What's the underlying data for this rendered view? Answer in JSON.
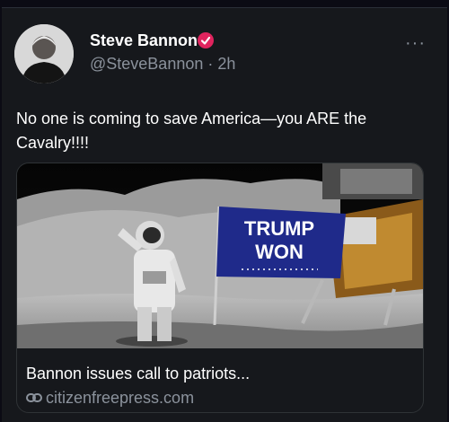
{
  "tweet": {
    "author_name": "Steve Bannon",
    "author_handle": "@SteveBannon",
    "time_separator": " · ",
    "time_ago": "2h",
    "more_label": "···",
    "text": "No one is coming to save America—you ARE the Cavalry!!!!",
    "avatar_icon": "avatar-photo",
    "verified_icon": "verified-badge-icon",
    "verified_color": "#e0245e"
  },
  "link_card": {
    "flag_text_line1": "TRUMP",
    "flag_text_line2": "WON",
    "title": "Bannon issues call to patriots...",
    "domain": "citizenfreepress.com",
    "link_icon": "link-icon"
  },
  "colors": {
    "background": "#16181c",
    "secondary_text": "#8b929c",
    "border": "#2f3336",
    "flag_blue": "#1f2a8a"
  }
}
